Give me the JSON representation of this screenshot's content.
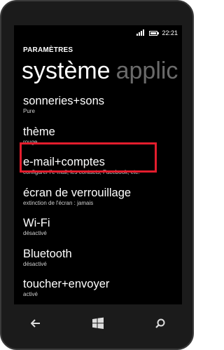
{
  "status": {
    "time": "22:21",
    "battery_level": 0.8,
    "network_icon": "signal-icon",
    "battery_icon": "battery-icon"
  },
  "header": {
    "title": "PARAMÈTRES"
  },
  "pivot": {
    "active": "système",
    "next": "applic"
  },
  "list": [
    {
      "title": "sonneries+sons",
      "subtitle": "Pure"
    },
    {
      "title": "thème",
      "subtitle": "rouge"
    },
    {
      "title": "e-mail+comptes",
      "subtitle": "configurer l'e-mail, les contacts, Facebook, etc."
    },
    {
      "title": "écran de verrouillage",
      "subtitle": "extinction de l'écran : jamais"
    },
    {
      "title": "Wi-Fi",
      "subtitle": "désactivé"
    },
    {
      "title": "Bluetooth",
      "subtitle": "désactivé"
    },
    {
      "title": "toucher+envoyer",
      "subtitle": "activé"
    }
  ],
  "colors": {
    "highlight": "#e31d2d",
    "background": "#000000",
    "inactive_pivot": "#6a6a6a"
  },
  "navbar": {
    "back_icon": "back-arrow-icon",
    "start_icon": "windows-logo-icon",
    "search_icon": "search-icon"
  }
}
